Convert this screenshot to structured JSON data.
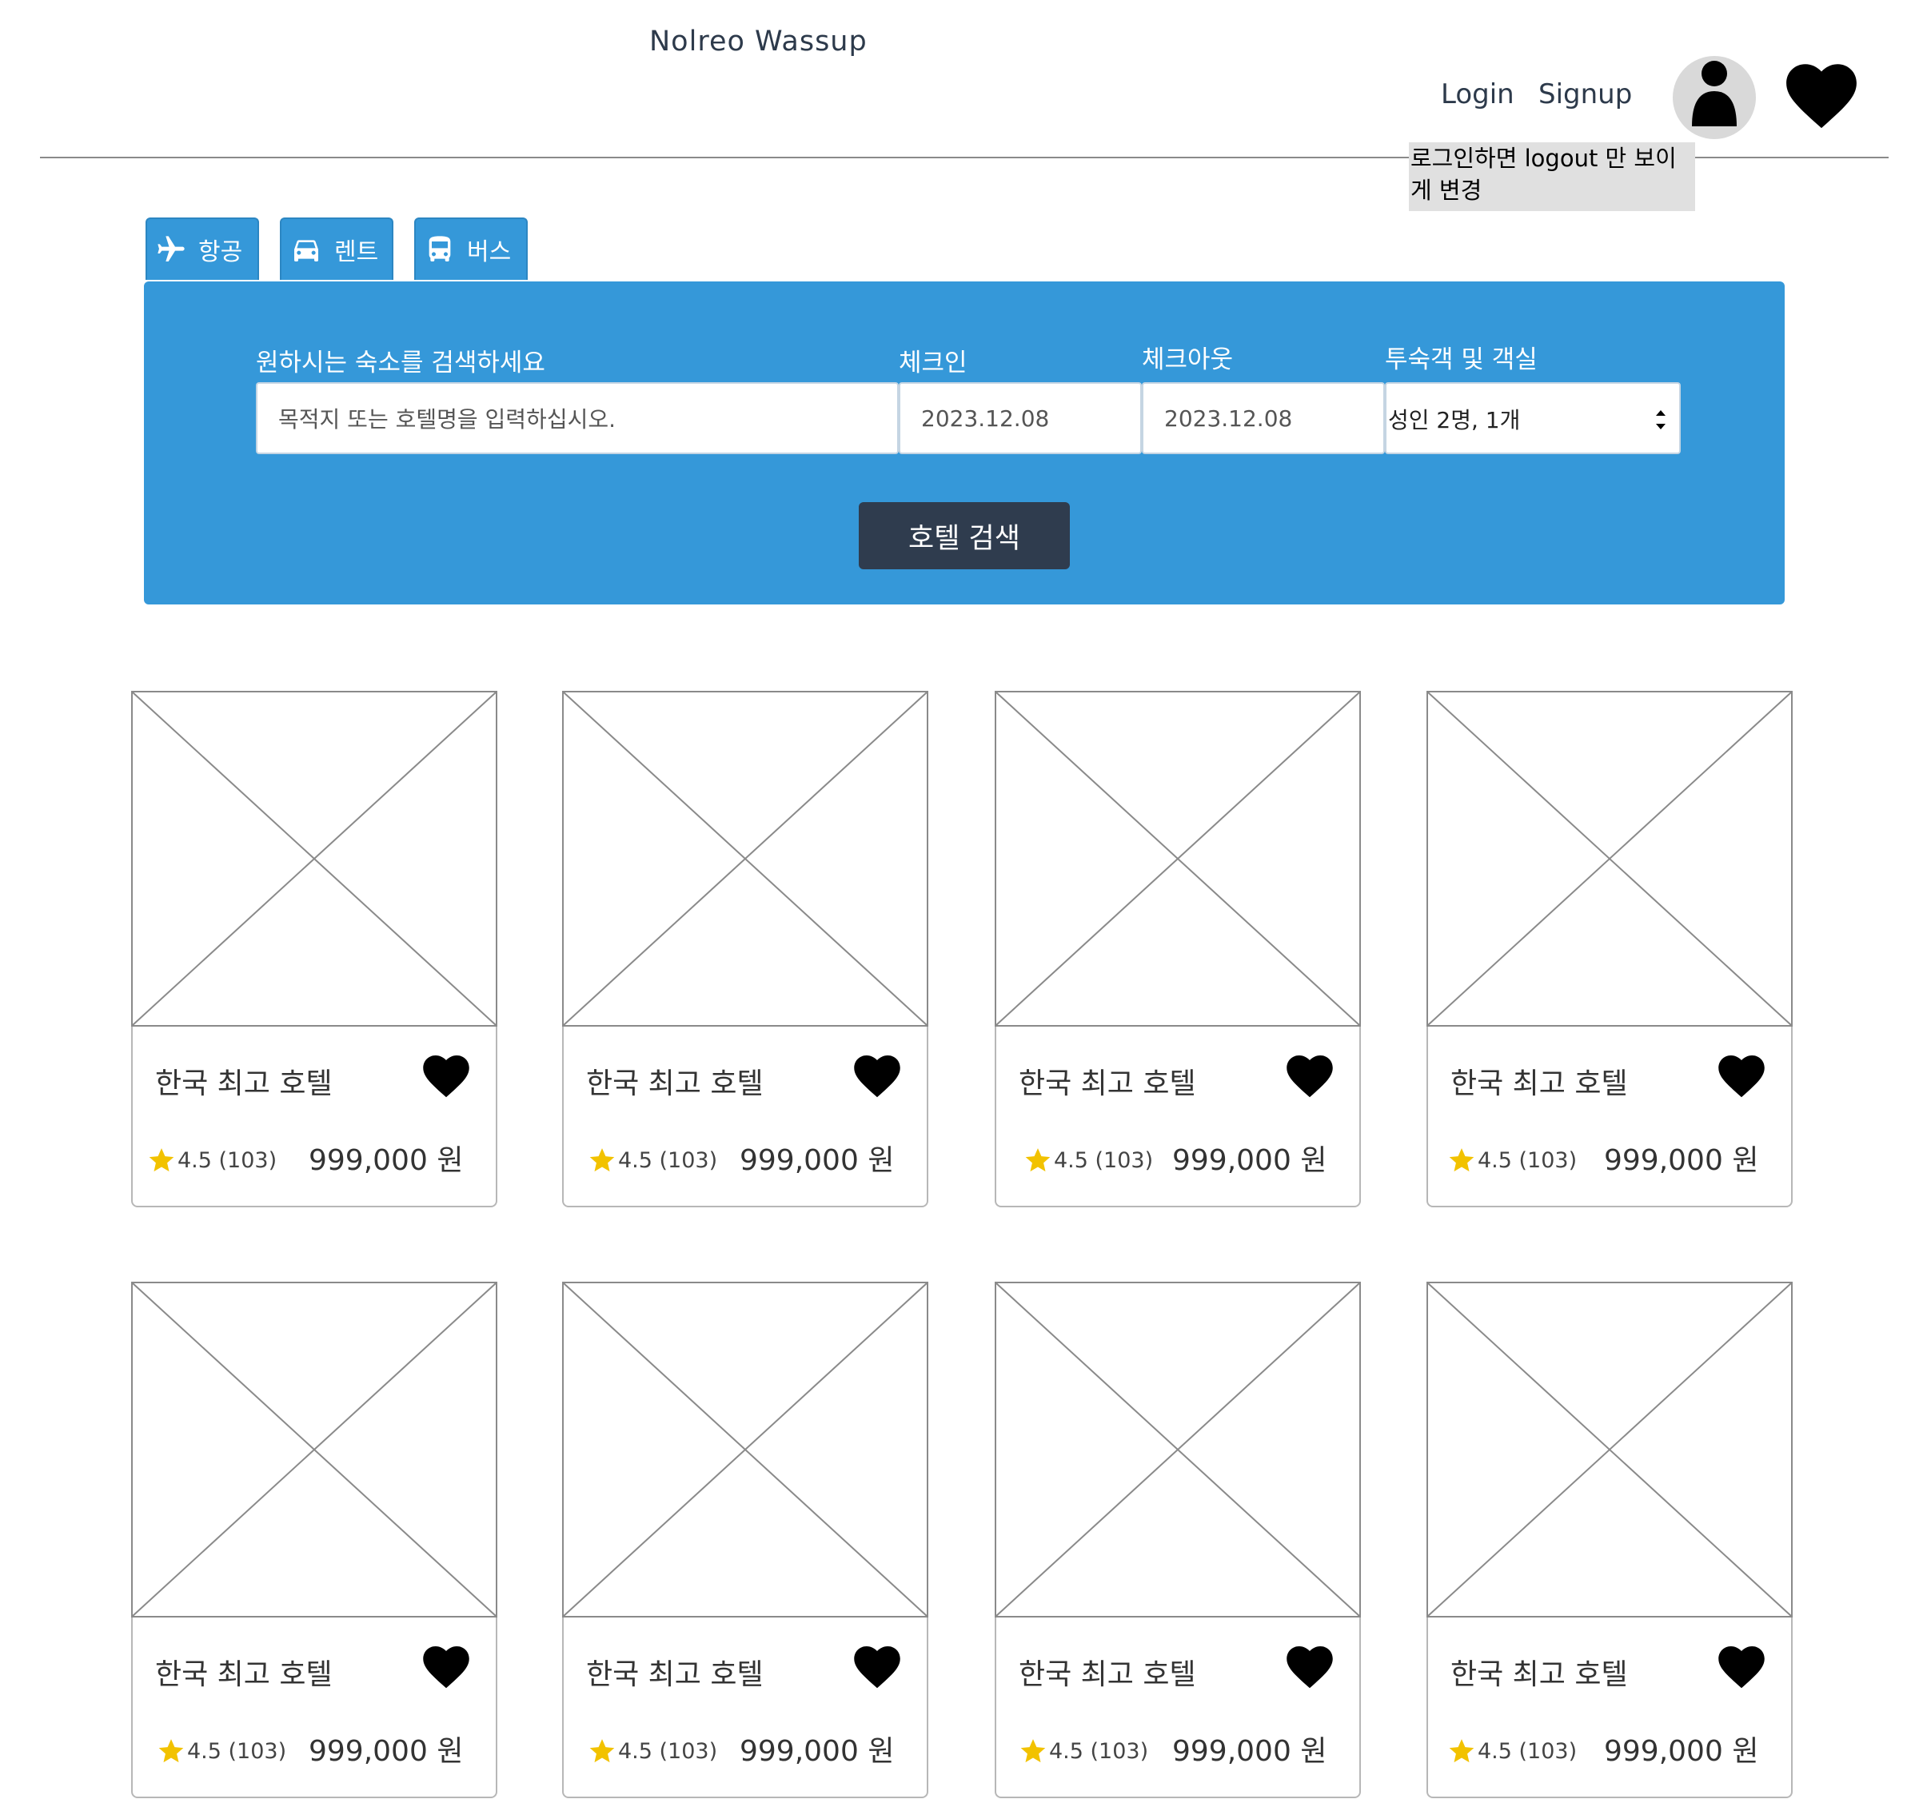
{
  "header": {
    "brand": "Nolreo Wassup",
    "login_label": "Login",
    "signup_label": "Signup",
    "note": "로그인하면 logout 만 보이게 변경"
  },
  "tabs": [
    {
      "icon": "airplane-icon",
      "label": "항공"
    },
    {
      "icon": "car-icon",
      "label": "렌트"
    },
    {
      "icon": "bus-icon",
      "label": "버스"
    }
  ],
  "search": {
    "destination_label": "원하시는 숙소를 검색하세요",
    "destination_placeholder": "목적지 또는 호텔명을 입력하십시오.",
    "checkin_label": "체크인",
    "checkin_value": "2023.12.08",
    "checkout_label": "체크아웃",
    "checkout_value": "2023.12.08",
    "guests_label": "투숙객 및 객실",
    "guests_value": "성인 2명, 1개",
    "button_label": "호텔 검색"
  },
  "hotels": [
    {
      "name": "한국 최고 호텔",
      "rating": "4.5 (103)",
      "price": "999,000 원"
    },
    {
      "name": "한국 최고 호텔",
      "rating": "4.5 (103)",
      "price": "999,000 원"
    },
    {
      "name": "한국 최고 호텔",
      "rating": "4.5 (103)",
      "price": "999,000 원"
    },
    {
      "name": "한국 최고 호텔",
      "rating": "4.5 (103)",
      "price": "999,000 원"
    },
    {
      "name": "한국 최고 호텔",
      "rating": "4.5 (103)",
      "price": "999,000 원"
    },
    {
      "name": "한국 최고 호텔",
      "rating": "4.5 (103)",
      "price": "999,000 원"
    },
    {
      "name": "한국 최고 호텔",
      "rating": "4.5 (103)",
      "price": "999,000 원"
    },
    {
      "name": "한국 최고 호텔",
      "rating": "4.5 (103)",
      "price": "999,000 원"
    }
  ],
  "colors": {
    "accent": "#3598d9",
    "button_dark": "#2f3c4e",
    "star": "#f2c200",
    "note_bg": "#e0e0e0"
  }
}
